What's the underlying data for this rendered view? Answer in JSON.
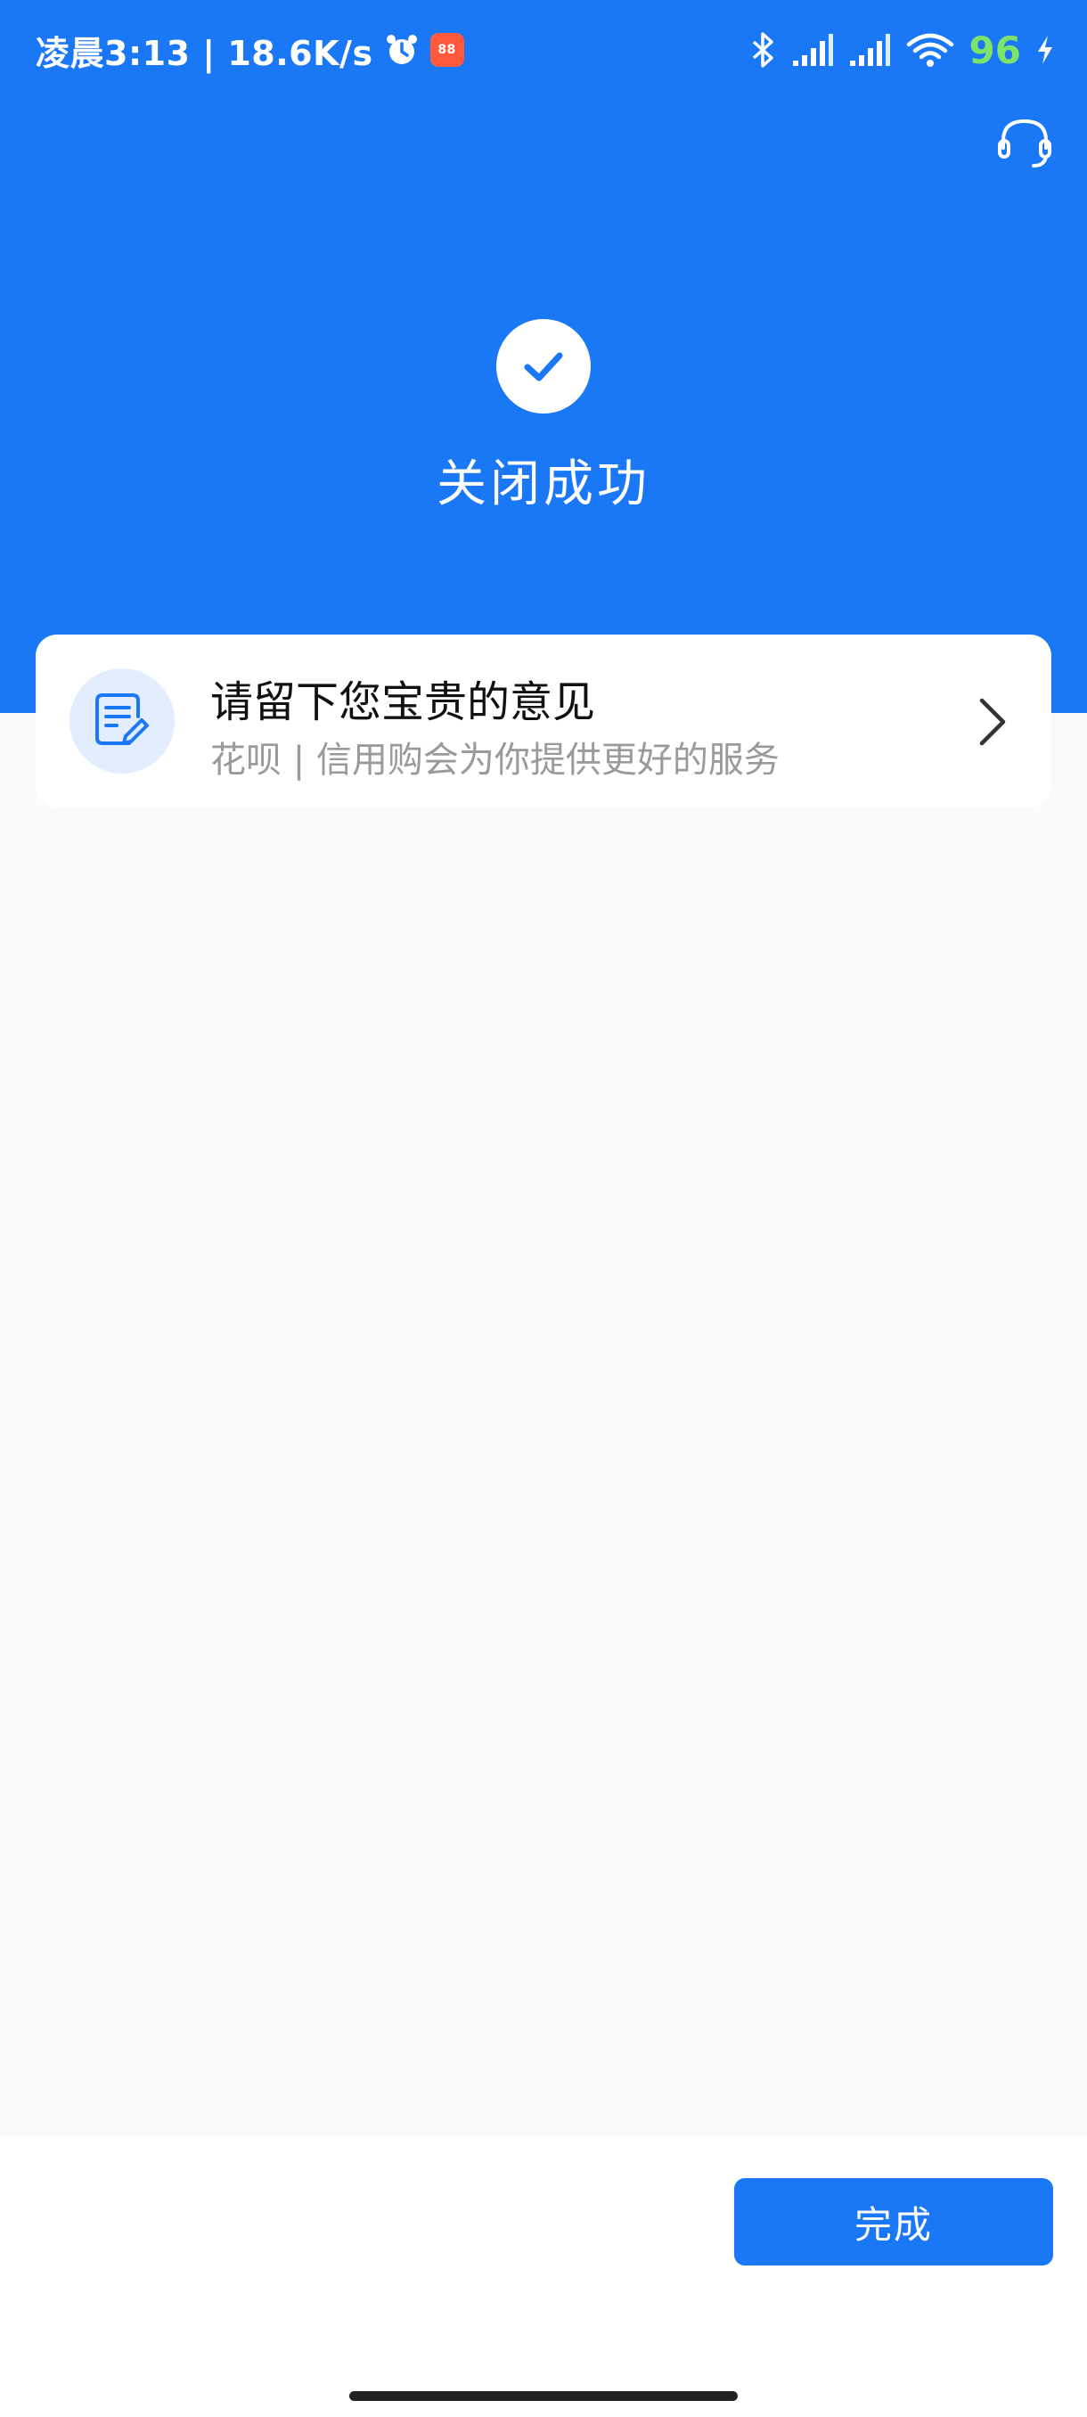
{
  "status_bar": {
    "time_speed": "凌晨3:13 | 18.6K/s",
    "app_badge": "88",
    "battery": "96",
    "icons": [
      "alarm-icon",
      "app-badge-icon",
      "bluetooth-icon",
      "signal-icon",
      "signal-icon",
      "wifi-icon",
      "charging-icon"
    ]
  },
  "header": {
    "support_icon": "headset-icon",
    "status_icon": "check-icon",
    "title": "关闭成功"
  },
  "feedback_card": {
    "icon": "note-edit-icon",
    "title": "请留下您宝贵的意见",
    "subtitle": "花呗 | 信用购会为你提供更好的服务",
    "chevron": "chevron-right-icon"
  },
  "footer": {
    "done_label": "完成"
  },
  "colors": {
    "brand_blue": "#1a77f5",
    "page_bg": "#f8fafc",
    "icon_bg": "#e2edfd",
    "battery_green": "#7ee36a"
  }
}
